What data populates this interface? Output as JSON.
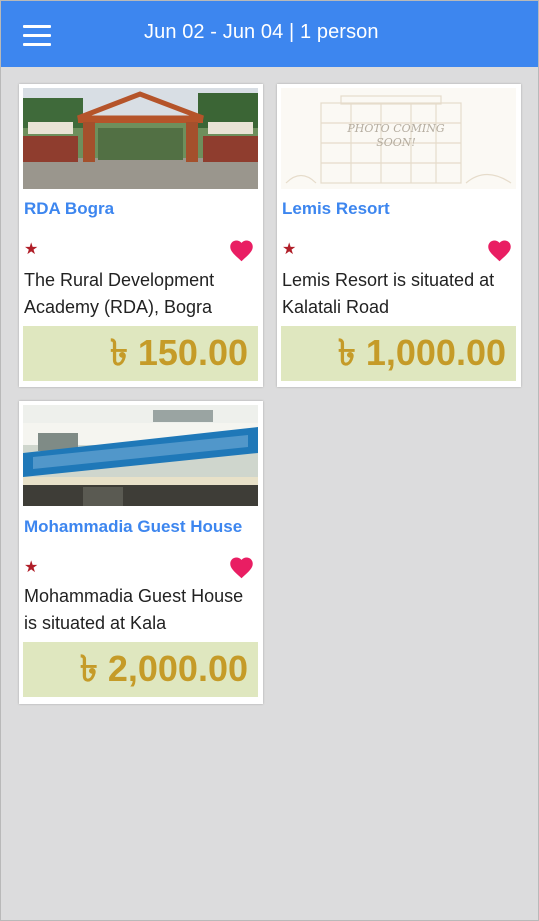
{
  "header": {
    "title": "Jun 02 - Jun 04 | 1 person"
  },
  "hotels": [
    {
      "name": "RDA Bogra",
      "stars": "★",
      "description": "The Rural Development Academy (RDA), Bogra",
      "price": "৳ 150.00",
      "image": "gate-photo"
    },
    {
      "name": "Lemis Resort",
      "stars": "★",
      "description": "Lemis Resort is situated at Kalatali Road",
      "price": "৳ 1,000.00",
      "image": "photo-coming-soon",
      "image_caption": "PHOTO COMING SOON!"
    },
    {
      "name": "Mohammadia Guest House",
      "stars": "★",
      "description": "Mohammadia Guest House is situated at Kala",
      "price": "৳ 2,000.00",
      "image": "guest-house-photo"
    }
  ],
  "colors": {
    "header": "#3d86ef",
    "hotel_name": "#3d86ef",
    "star": "#b01e28",
    "heart": "#e91e63",
    "price_text": "#c59b28",
    "price_bg": "#dfe7bf",
    "background": "#dcdcdd"
  }
}
